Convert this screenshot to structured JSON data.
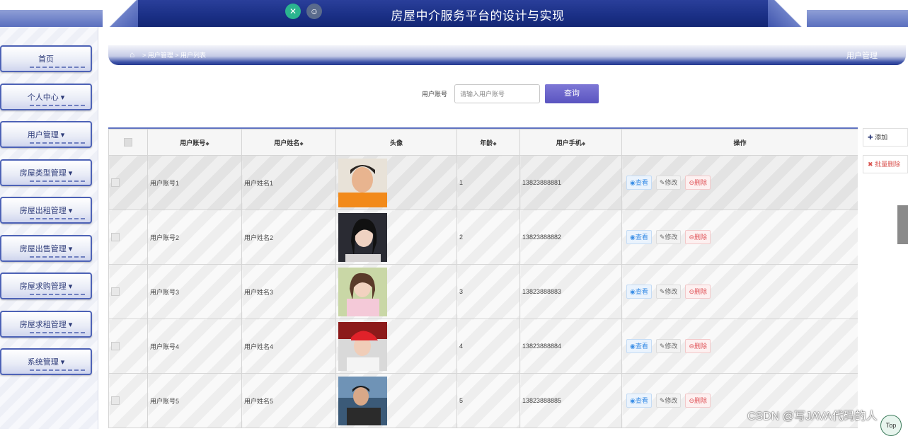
{
  "header": {
    "title": "房屋中介服务平台的设计与实现"
  },
  "sidebar": {
    "items": [
      {
        "label": "首页"
      },
      {
        "label": "个人中心 ▾"
      },
      {
        "label": "用户管理 ▾"
      },
      {
        "label": "房屋类型管理 ▾"
      },
      {
        "label": "房屋出租管理 ▾"
      },
      {
        "label": "房屋出售管理 ▾"
      },
      {
        "label": "房屋求购管理 ▾"
      },
      {
        "label": "房屋求租管理 ▾"
      },
      {
        "label": "系统管理 ▾"
      }
    ]
  },
  "breadcrumb": {
    "path": "> 用户管理 > 用户列表",
    "current": "用户管理"
  },
  "search": {
    "label": "用户账号",
    "placeholder": "请输入用户账号",
    "button": "查询"
  },
  "actions": {
    "add": "添加",
    "batch_delete": "批量删除"
  },
  "table": {
    "headers": [
      "用户账号",
      "用户姓名",
      "头像",
      "年龄",
      "用户手机",
      "操作"
    ],
    "rows": [
      {
        "account": "用户账号1",
        "name": "用户姓名1",
        "age": "1",
        "phone": "13823888881"
      },
      {
        "account": "用户账号2",
        "name": "用户姓名2",
        "age": "2",
        "phone": "13823888882"
      },
      {
        "account": "用户账号3",
        "name": "用户姓名3",
        "age": "3",
        "phone": "13823888883"
      },
      {
        "account": "用户账号4",
        "name": "用户姓名4",
        "age": "4",
        "phone": "13823888884"
      },
      {
        "account": "用户账号5",
        "name": "用户姓名5",
        "age": "5",
        "phone": "13823888885"
      }
    ],
    "ops": {
      "view": "查看",
      "edit": "修改",
      "delete": "删除"
    }
  },
  "watermark": "CSDN @写JAVA代码的人",
  "top_button": "Top"
}
